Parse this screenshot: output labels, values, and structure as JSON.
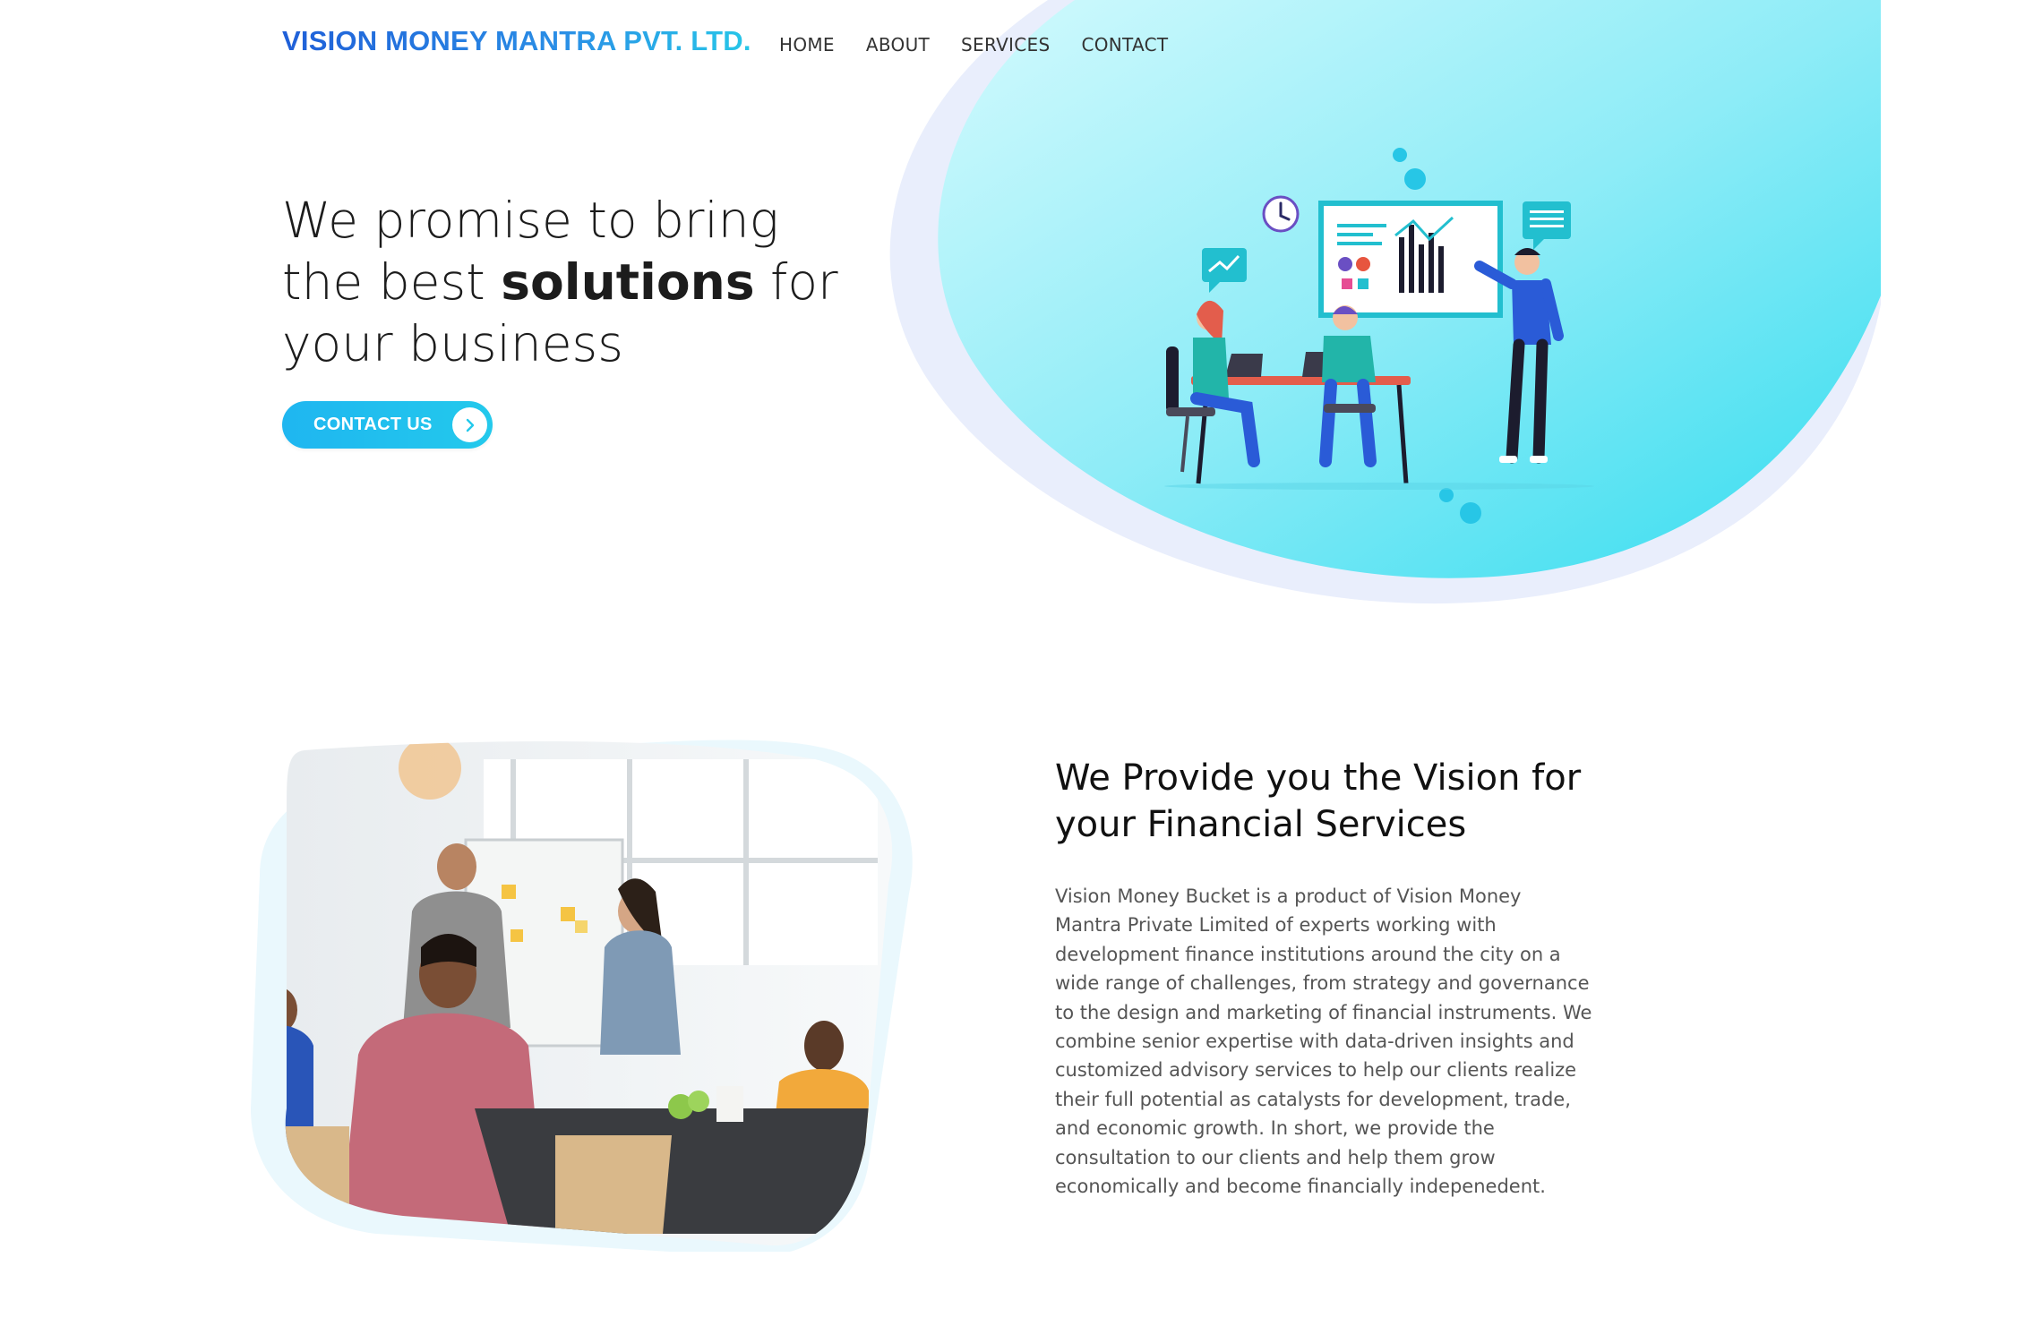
{
  "header": {
    "brand": "VISION MONEY MANTRA PVT. LTD.",
    "nav": [
      "HOME",
      "ABOUT",
      "SERVICES",
      "CONTACT"
    ]
  },
  "hero": {
    "title_part1": "We promise to bring the best ",
    "title_bold": "solutions",
    "title_part2": " for your business",
    "cta_label": "CONTACT US",
    "illustration_icon": "business-presentation-illustration"
  },
  "about": {
    "title": "We Provide you the Vision for your Financial Services",
    "body": "Vision Money Bucket is a product of Vision Money Mantra Private Limited of experts working with development finance institutions around the city on a wide range of challenges, from strategy and governance to the design and marketing of financial instruments. We combine senior expertise with data-driven insights and customized advisory services to help our clients realize their full potential as catalysts for development, trade, and economic growth. In short, we provide the consultation to our clients and help them grow economically and become financially indepenedent.",
    "photo_icon": "team-meeting-photo"
  },
  "colors": {
    "accent": "#23c9ec",
    "brand_blue": "#1f5fd8",
    "blob_light": "#c6f6fb",
    "blob_deep": "#3ae0f0",
    "lavender": "#e8edfb"
  }
}
